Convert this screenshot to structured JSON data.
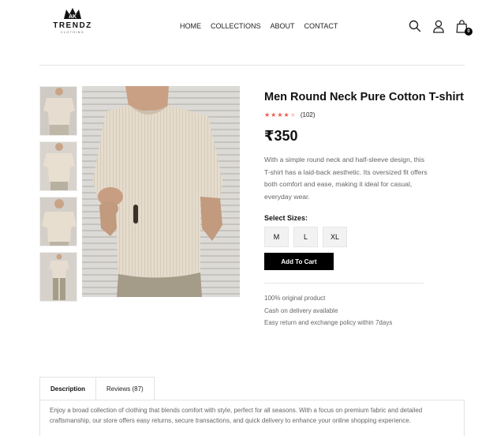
{
  "header": {
    "logo_mark": "AK",
    "logo_brand": "TRENDZ",
    "logo_sub": "CLOTHING",
    "nav": [
      {
        "label": "HOME"
      },
      {
        "label": "COLLECTIONS"
      },
      {
        "label": "ABOUT"
      },
      {
        "label": "CONTACT"
      }
    ],
    "cart_count": "0",
    "icons": [
      "search-icon",
      "user-icon",
      "shopping-bag-icon"
    ]
  },
  "product": {
    "title": "Men Round Neck Pure Cotton T-shirt",
    "rating": 4,
    "rating_max": 5,
    "review_count": "(102)",
    "price": "₹350",
    "description": "With a simple round neck and half-sleeve design, this T-shirt has a laid-back aesthetic. Its oversized fit offers both comfort and ease, making it ideal for casual, everyday wear.",
    "sizes_label": "Select Sizes:",
    "sizes": [
      "M",
      "L",
      "XL"
    ],
    "add_to_cart": "Add To Cart",
    "perks": [
      "100% original product",
      "Cash on delivery available",
      "Easy return and exchange policy within 7days"
    ],
    "thumbnail_count": 4
  },
  "tabs": [
    {
      "label": "Description",
      "active": true
    },
    {
      "label": "Reviews (87)",
      "active": false
    }
  ],
  "tab_content": "Enjoy a broad collection of clothing that blends comfort with style, perfect for all seasons. With a focus on premium fabric and detailed craftsmanship, our store offers easy returns, secure transactions, and quick delivery to enhance your online shopping experience.",
  "colors": {
    "accent": "#000000",
    "star_filled": "#f0574a",
    "star_empty": "#f7c6c1",
    "text_muted": "#666666"
  }
}
